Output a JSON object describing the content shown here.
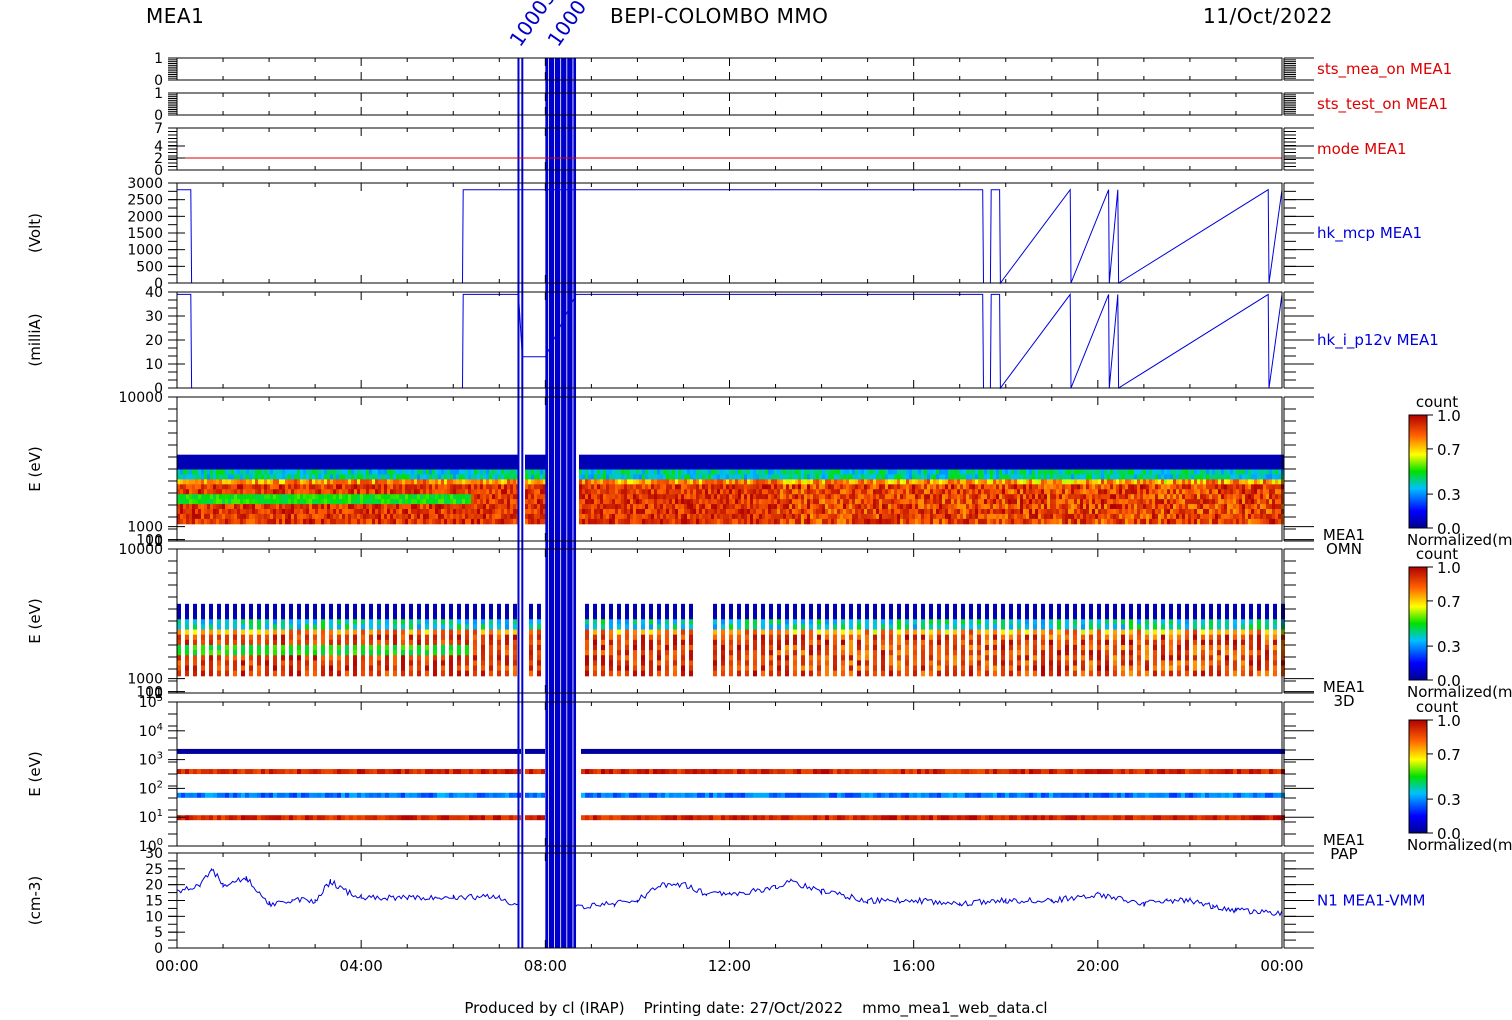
{
  "header": {
    "left": "MEA1",
    "center": "BEPI-COLOMBO MMO",
    "right": "11/Oct/2022",
    "overlap_labels": [
      "10003",
      "1000"
    ]
  },
  "footer": "Produced by cl (IRAP)    Printing date: 27/Oct/2022    mmo_mea1_web_data.cl",
  "colors": {
    "status_line": "#dd0000",
    "housekeeping_line": "#0000dd",
    "gap_band": "#0000cc",
    "dashed_zero": "#000000"
  },
  "chart_data": [
    {
      "type": "line",
      "name": "sts_mea_on MEA1",
      "yticks": [
        "1",
        "0"
      ],
      "ylim": [
        0,
        1
      ],
      "x": [
        "00:00",
        "24:00"
      ],
      "values": [
        1,
        1
      ]
    },
    {
      "type": "line",
      "name": "sts_test_on MEA1",
      "yticks": [
        "1",
        "0"
      ],
      "ylim": [
        0,
        1
      ],
      "x": [
        "00:00",
        "24:00"
      ],
      "values": [
        0,
        0
      ]
    },
    {
      "type": "line",
      "name": "mode MEA1",
      "yticks": [
        "7",
        "4",
        "2",
        "0"
      ],
      "ylim": [
        0,
        7
      ],
      "x": [
        "00:00",
        "24:00"
      ],
      "values": [
        2,
        2
      ]
    },
    {
      "type": "line",
      "name": "hk_mcp MEA1",
      "ylabel": "(Volt)",
      "yticks": [
        "3000",
        "2500",
        "2000",
        "1500",
        "1000",
        "500",
        "0"
      ],
      "ylim": [
        0,
        3000
      ],
      "x": [
        "00:00",
        "00:18",
        "00:19",
        "06:12",
        "06:13",
        "07:25",
        "17:30",
        "17:31",
        "17:40",
        "17:41",
        "17:52",
        "17:53",
        "19:24",
        "19:25",
        "20:14",
        "20:15",
        "20:26",
        "20:27",
        "23:42",
        "23:43",
        "24:00"
      ],
      "values": [
        2800,
        2800,
        0,
        0,
        2800,
        2800,
        2800,
        0,
        0,
        2800,
        2800,
        0,
        2800,
        0,
        2800,
        0,
        2800,
        0,
        2800,
        0,
        2800
      ]
    },
    {
      "type": "line",
      "name": "hk_i_p12v MEA1",
      "ylabel": "(milliA)",
      "yticks": [
        "40",
        "30",
        "20",
        "10",
        "0"
      ],
      "ylim": [
        0,
        40
      ],
      "x": [
        "00:00",
        "00:18",
        "00:19",
        "06:12",
        "06:13",
        "07:25",
        "07:30",
        "08:00",
        "08:40",
        "17:30",
        "17:31",
        "17:40",
        "17:41",
        "17:52",
        "17:53",
        "19:24",
        "19:25",
        "20:14",
        "20:15",
        "20:26",
        "20:27",
        "23:42",
        "23:43",
        "24:00"
      ],
      "values": [
        39,
        39,
        0,
        0,
        39,
        39,
        13,
        13,
        39,
        39,
        0,
        0,
        39,
        39,
        0,
        39,
        0,
        39,
        0,
        39,
        0,
        39,
        0,
        39
      ]
    },
    {
      "type": "heatmap",
      "name": "MEA1 OMN",
      "label_lines": [
        "MEA1",
        "OMN"
      ],
      "ylabel": "E (eV)",
      "yticks": [
        "10000",
        "1000",
        "100",
        "10",
        "1"
      ],
      "yscale": "log",
      "ylim": [
        1,
        10000
      ],
      "energy_range": [
        3,
        250
      ],
      "colorbar": {
        "title": "count",
        "ticks": [
          "1.0",
          "0.7",
          "0.3",
          "0.0"
        ],
        "label": "Normalized(m"
      }
    },
    {
      "type": "heatmap",
      "name": "MEA1 3D",
      "label_lines": [
        "MEA1",
        "3D"
      ],
      "ylabel": "E (eV)",
      "yticks": [
        "10000",
        "1000",
        "100",
        "10",
        "1"
      ],
      "yscale": "log",
      "ylim": [
        1,
        10000
      ],
      "energy_range": [
        3,
        300
      ],
      "colorbar": {
        "title": "count",
        "ticks": [
          "1.0",
          "0.7",
          "0.3",
          "0.0"
        ],
        "label": "Normalized(m"
      }
    },
    {
      "type": "heatmap",
      "name": "MEA1 PAP",
      "label_lines": [
        "MEA1",
        "PAP"
      ],
      "ylabel": "E (eV)",
      "yticks": [
        "10^5",
        "10^4",
        "10^3",
        "10^2",
        "10^1",
        "10^0"
      ],
      "yscale": "log",
      "ylim": [
        1,
        100000
      ],
      "energy_bands": [
        2000,
        400,
        60,
        10
      ],
      "colorbar": {
        "title": "count",
        "ticks": [
          "1.0",
          "0.7",
          "0.3",
          "0.0"
        ],
        "label": "Normalized(m"
      }
    },
    {
      "type": "line",
      "name": "N1 MEA1-VMM",
      "ylabel": "(cm-3)",
      "yticks": [
        "30",
        "25",
        "20",
        "15",
        "10",
        "5",
        "0"
      ],
      "ylim": [
        0,
        30
      ],
      "x": [
        "00:00",
        "00:30",
        "00:45",
        "01:00",
        "01:30",
        "02:00",
        "02:30",
        "03:00",
        "03:20",
        "03:40",
        "04:00",
        "05:00",
        "06:00",
        "07:00",
        "07:25",
        "08:40",
        "09:30",
        "10:00",
        "10:30",
        "11:00",
        "11:30",
        "12:00",
        "13:00",
        "13:20",
        "14:00",
        "15:00",
        "16:00",
        "17:00",
        "18:00",
        "19:00",
        "20:00",
        "21:00",
        "21:30",
        "22:00",
        "22:30",
        "23:00",
        "24:00"
      ],
      "values": [
        18,
        20,
        25,
        20,
        22,
        14,
        15,
        15,
        21,
        18,
        16,
        16,
        16,
        16,
        13,
        13,
        14,
        15,
        20,
        20,
        17,
        17,
        19,
        21,
        18,
        15,
        15,
        14,
        15,
        15,
        17,
        14,
        15,
        15,
        13,
        12,
        11
      ]
    }
  ],
  "time_axis": {
    "ticks": [
      "00:00",
      "04:00",
      "08:00",
      "12:00",
      "16:00",
      "20:00",
      "00:00"
    ],
    "range_hours": [
      0,
      24
    ]
  },
  "gaps": [
    {
      "from": "07:25",
      "to": "07:30"
    },
    {
      "from": "08:00",
      "to": "08:40"
    }
  ]
}
